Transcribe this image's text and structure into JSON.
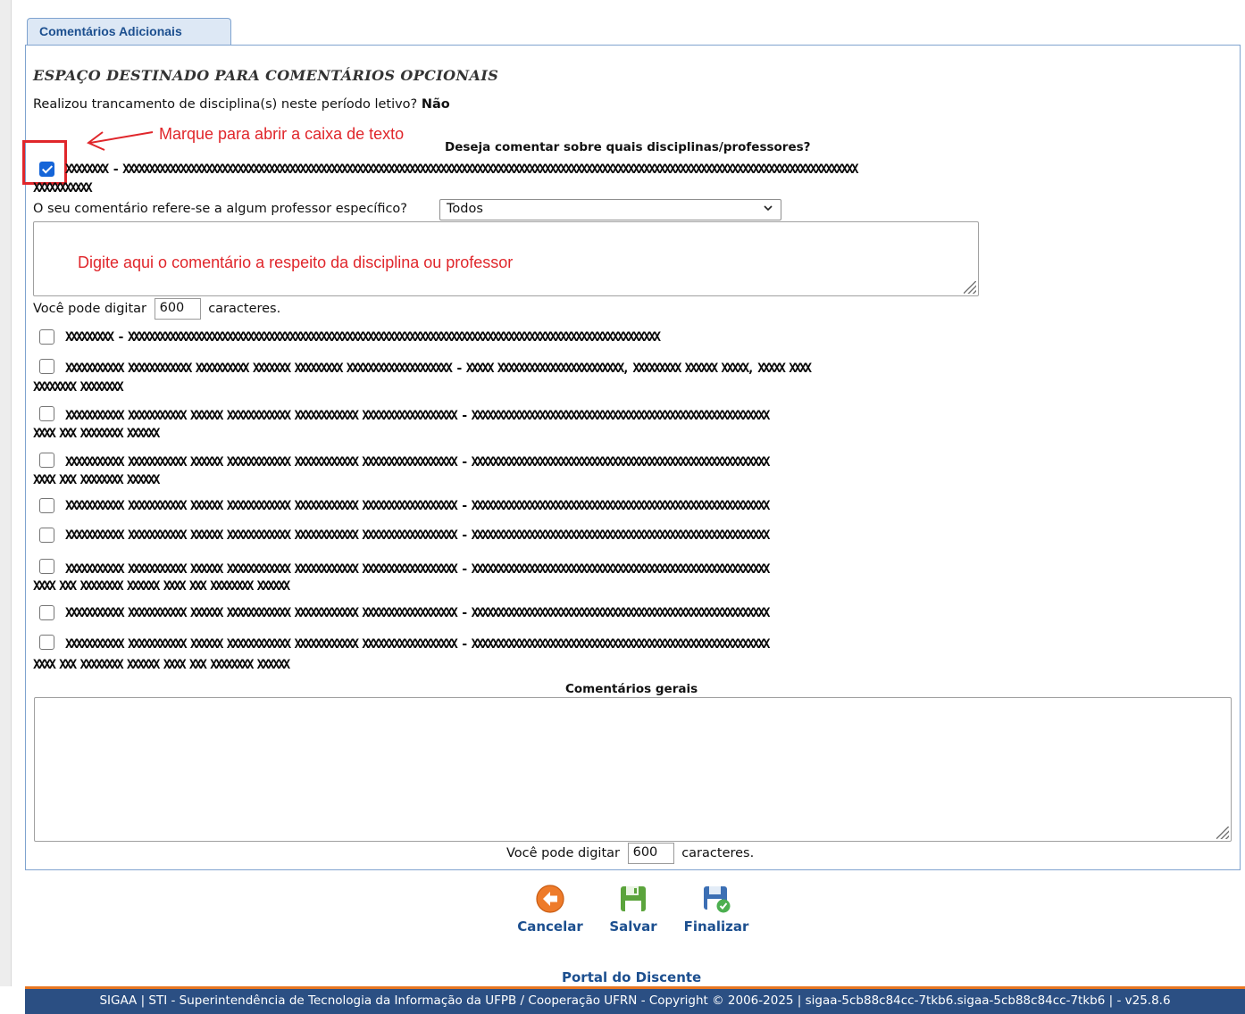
{
  "tab": {
    "label": "Comentários Adicionais"
  },
  "section": {
    "title": "ESPAÇO DESTINADO PARA COMENTÁRIOS OPCIONAIS"
  },
  "trancamento": {
    "question": "Realizou trancamento de disciplina(s) neste período letivo?",
    "answer": "Não"
  },
  "annotations": {
    "checkbox_hint": "Marque para abrir a caixa de texto",
    "textarea_hint": "Digite aqui o comentário a respeito da disciplina ou professor"
  },
  "disciplines": {
    "header": "Deseja comentar sobre quais disciplinas/professores?",
    "items": [
      {
        "checked": true,
        "line1": "XXXXXXXX - XXXXXXXXXXXXXXXXXXXXXXXXXXXXXXXXXXXXXXXXXXXXXXXXXXXXXXXXXXXXXXXXXXXXXXXXXXXXXXXXXXXXXXXXXXXXXXXXXXXXXXXXXXXXXXXXXXXXXXXXXXXXXXXXXXXXXXXXXXXXX",
        "line2": "XXXXXXXXXXX"
      },
      {
        "checked": false,
        "line1": "XXXXXXXXX - XXXXXXXXXXXXXXXXXXXXXXXXXXXXXXXXXXXXXXXXXXXXXXXXXXXXXXXXXXXXXXXXXXXXXXXXXXXXXXXXXXXXXXXXXXXXXXXXXXXXXX",
        "line2": ""
      },
      {
        "checked": false,
        "line1": "XXXXXXXXXXX XXXXXXXXXXXX XXXXXXXXXX XXXXXXX XXXXXXXXX XXXXXXXXXXXXXXXXXXXX - XXXXX XXXXXXXXXXXXXXXXXXXXXXXX, XXXXXXXXX XXXXXX XXXXX, XXXXX XXXX",
        "line2": "XXXXXXXX XXXXXXXX"
      },
      {
        "checked": false,
        "line1": "XXXXXXXXXXX XXXXXXXXXXX XXXXXX XXXXXXXXXXXX XXXXXXXXXXXX XXXXXXXXXXXXXXXXXX - XXXXXXXXXXXXXXXXXXXXXXXXXXXXXXXXXXXXXXXXXXXXXXXXXXXXXXXXX",
        "line2": "XXXX XXX XXXXXXXX XXXXXX"
      },
      {
        "checked": false,
        "line1": "XXXXXXXXXXX XXXXXXXXXXX XXXXXX XXXXXXXXXXXX XXXXXXXXXXXX XXXXXXXXXXXXXXXXXX - XXXXXXXXXXXXXXXXXXXXXXXXXXXXXXXXXXXXXXXXXXXXXXXXXXXXXXXXX",
        "line2": "XXXX XXX XXXXXXXX XXXXXX"
      },
      {
        "checked": false,
        "line1": "XXXXXXXXXXX XXXXXXXXXXX XXXXXX XXXXXXXXXXXX XXXXXXXXXXXX XXXXXXXXXXXXXXXXXX - XXXXXXXXXXXXXXXXXXXXXXXXXXXXXXXXXXXXXXXXXXXXXXXXXXXXXXXXX",
        "line2": ""
      },
      {
        "checked": false,
        "line1": "XXXXXXXXXXX XXXXXXXXXXX XXXXXX XXXXXXXXXXXX XXXXXXXXXXXX XXXXXXXXXXXXXXXXXX - XXXXXXXXXXXXXXXXXXXXXXXXXXXXXXXXXXXXXXXXXXXXXXXXXXXXXXXXX",
        "line2": ""
      },
      {
        "checked": false,
        "line1": "XXXXXXXXXXX XXXXXXXXXXX XXXXXX XXXXXXXXXXXX XXXXXXXXXXXX XXXXXXXXXXXXXXXXXX - XXXXXXXXXXXXXXXXXXXXXXXXXXXXXXXXXXXXXXXXXXXXXXXXXXXXXXXXX",
        "line2": "XXXX XXX XXXXXXXX XXXXXX     XXXX XXX XXXXXXXX XXXXXX"
      },
      {
        "checked": false,
        "line1": "XXXXXXXXXXX XXXXXXXXXXX XXXXXX XXXXXXXXXXXX XXXXXXXXXXXX XXXXXXXXXXXXXXXXXX - XXXXXXXXXXXXXXXXXXXXXXXXXXXXXXXXXXXXXXXXXXXXXXXXXXXXXXXXX",
        "line2": ""
      },
      {
        "checked": false,
        "line1": "XXXXXXXXXXX XXXXXXXXXXX XXXXXX XXXXXXXXXXXX XXXXXXXXXXXX XXXXXXXXXXXXXXXXXX - XXXXXXXXXXXXXXXXXXXXXXXXXXXXXXXXXXXXXXXXXXXXXXXXXXXXXXXXX",
        "line2": "XXXX XXX XXXXXXXX XXXXXX     XXXX XXX XXXXXXXX XXXXXX"
      }
    ]
  },
  "professor": {
    "label": "O seu comentário refere-se a algum professor específico?",
    "selected": "Todos"
  },
  "counter": {
    "prefix": "Você pode digitar",
    "value": "600",
    "suffix": "caracteres."
  },
  "general": {
    "label": "Comentários gerais"
  },
  "actions": {
    "cancel": "Cancelar",
    "save": "Salvar",
    "finish": "Finalizar"
  },
  "portal": {
    "label": "Portal do Discente"
  },
  "footer": {
    "text": "SIGAA | STI - Superintendência de Tecnologia da Informação da UFPB / Cooperação UFRN - Copyright © 2006-2025 | sigaa-5cb88c84cc-7tkb6.sigaa-5cb88c84cc-7tkb6 | - v25.8.6"
  },
  "colors": {
    "accent": "#1c4f8f",
    "annotation": "#e0262b",
    "footer_bg": "#2b4f83",
    "footer_border": "#e87722"
  }
}
